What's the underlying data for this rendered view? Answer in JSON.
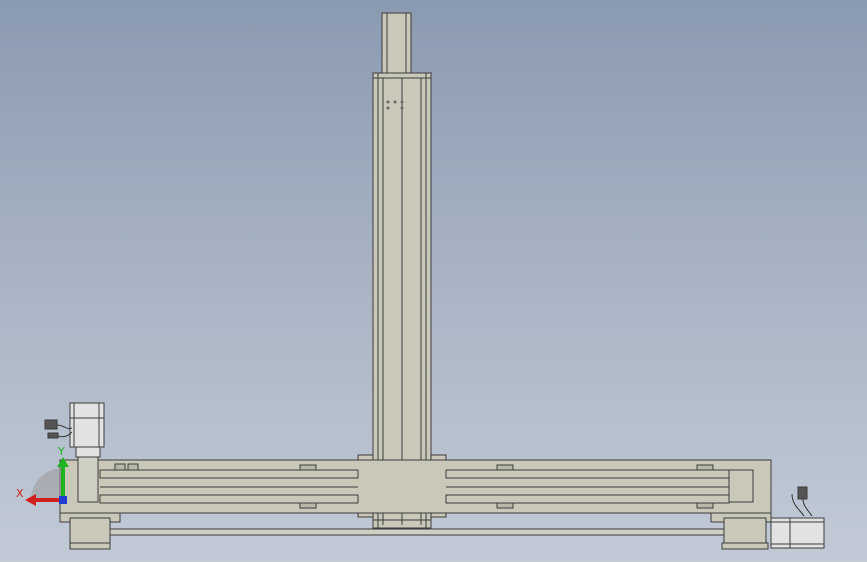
{
  "viewport": {
    "background_top": "#8a9ab0",
    "background_bottom": "#c2cad6"
  },
  "model": {
    "frame_fill": "#c9c8b9",
    "frame_stroke": "#3c3c3c",
    "motor_fill": "#e2e2e2"
  },
  "triad": {
    "x_label": "X",
    "y_label": "Y",
    "x_color": "#d21e1e",
    "y_color": "#1eb41e",
    "z_color": "#1e3cd2"
  }
}
